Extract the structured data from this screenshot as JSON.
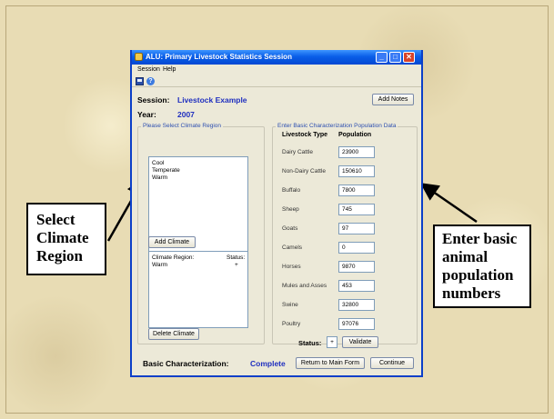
{
  "window": {
    "title": "ALU: Primary Livestock Statistics Session",
    "controls": {
      "minimize": "_",
      "maximize": "□",
      "close": "✕"
    }
  },
  "menu": {
    "items": [
      "Session",
      "Help"
    ]
  },
  "toolbar": {
    "icons": [
      "save-icon",
      "help-icon"
    ],
    "help_glyph": "?"
  },
  "session": {
    "session_label": "Session:",
    "session_value": "Livestock Example",
    "year_label": "Year:",
    "year_value": "2007",
    "add_notes_button": "Add Notes"
  },
  "climate": {
    "group_title": "Please Select Climate Region",
    "options": [
      "Cool",
      "Temperate",
      "Warm"
    ],
    "add_button": "Add Climate",
    "selected_header_region": "Climate Region:",
    "selected_header_status": "Status:",
    "selected_rows": [
      {
        "region": "Warm",
        "status": "+"
      }
    ],
    "delete_button": "Delete Climate"
  },
  "population": {
    "group_title": "Enter Basic Characterization Population Data",
    "col_type": "Livestock Type",
    "col_population": "Population",
    "rows": [
      {
        "type": "Dairy Cattle",
        "value": "23900"
      },
      {
        "type": "Non-Dairy Cattle",
        "value": "150610"
      },
      {
        "type": "Buffalo",
        "value": "7800"
      },
      {
        "type": "Sheep",
        "value": "745"
      },
      {
        "type": "Goats",
        "value": "97"
      },
      {
        "type": "Camels",
        "value": "0"
      },
      {
        "type": "Horses",
        "value": "9870"
      },
      {
        "type": "Mules and Asses",
        "value": "453"
      },
      {
        "type": "Swine",
        "value": "32800"
      },
      {
        "type": "Poultry",
        "value": "97076"
      }
    ],
    "status_label": "Status:",
    "status_value": "+",
    "validate_button": "Validate"
  },
  "footer": {
    "basic_label": "Basic Characterization:",
    "basic_value": "Complete",
    "return_button": "Return to Main Form",
    "continue_button": "Continue"
  },
  "annotations": {
    "left_text": "Select Climate Region",
    "right_text": "Enter basic animal population numbers"
  },
  "colors": {
    "accent_blue": "#1f2fbf",
    "titlebar": "#0a5ee8",
    "background": "#e8dcb4"
  }
}
